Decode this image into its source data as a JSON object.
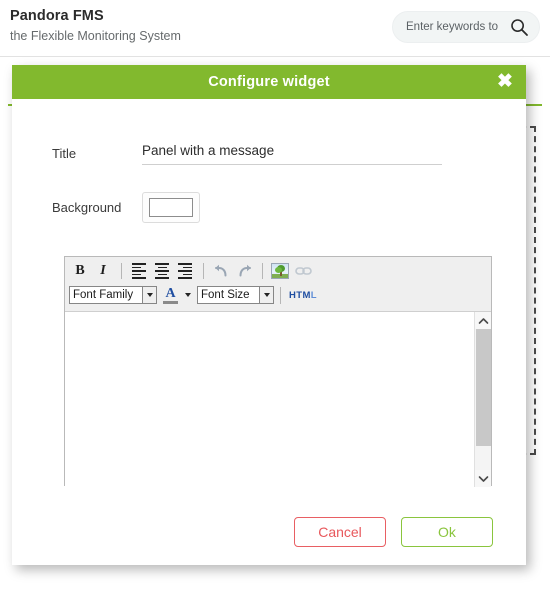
{
  "header": {
    "brand_title": "Pandora FMS",
    "brand_subtitle": "the Flexible Monitoring System",
    "search_placeholder": "Enter keywords to",
    "search_value": "",
    "search_icon": "search-icon"
  },
  "modal": {
    "title": "Configure widget",
    "close_icon": "close-icon",
    "header_color": "#82b92e",
    "fields": {
      "title_label": "Title",
      "title_value": "Panel with a message",
      "background_label": "Background",
      "background_color": "#ffffff"
    },
    "editor": {
      "toolbar_row1": [
        {
          "name": "bold-button",
          "label": "B"
        },
        {
          "name": "italic-button",
          "label": "I"
        },
        {
          "name": "align-left-button",
          "label": "Align left"
        },
        {
          "name": "align-center-button",
          "label": "Align center"
        },
        {
          "name": "align-justify-button",
          "label": "Justify"
        },
        {
          "name": "undo-button",
          "label": "Undo"
        },
        {
          "name": "redo-button",
          "label": "Redo"
        },
        {
          "name": "insert-image-button",
          "label": "Insert image"
        },
        {
          "name": "insert-link-button",
          "label": "Insert link"
        }
      ],
      "font_family_label": "Font Family",
      "forecolor_label": "A",
      "font_size_label": "Font Size",
      "html_label_part1": "HTM",
      "html_label_part2": "L",
      "content_value": ""
    },
    "buttons": {
      "cancel_label": "Cancel",
      "cancel_color": "#e8585c",
      "ok_label": "Ok",
      "ok_color": "#8ac53e"
    }
  }
}
